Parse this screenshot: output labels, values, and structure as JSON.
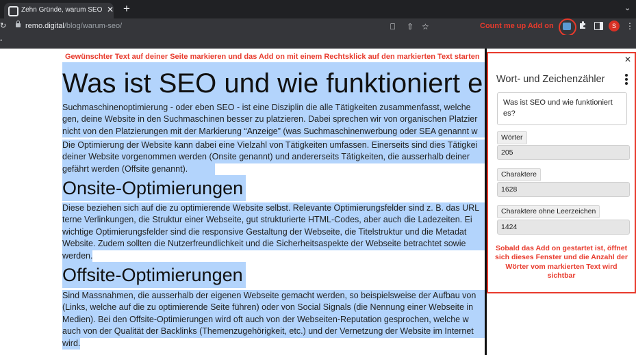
{
  "browser": {
    "tab_title": "Zehn Gründe, warum SEO wich",
    "tab_close": "✕",
    "new_tab": "+",
    "url_host": "remo.digital",
    "url_path": "/blog/warum-seo/"
  },
  "annotations": {
    "toolbar_label": "Count me up Add on",
    "instruction": "Gewünschter Text auf deiner Seite markieren und das Add on mit einem Rechtsklick auf den markierten Text starten",
    "panel_note": "Sobald das Add on gestartet ist, öffnet sich dieses Fenster und die Anzahl der Wörter vom markierten Text wird sichtbar"
  },
  "profile": {
    "initial": "S"
  },
  "article": {
    "title": "Was ist SEO und wie funktioniert e",
    "intro_lines": [
      "Suchmaschinenoptimierung - oder eben SEO - ist eine Disziplin die alle Tätigkeiten zusammenfasst, welche",
      "gen, deine Website in den Suchmaschinen besser zu platzieren. Dabei sprechen wir von organischen Platzier",
      "nicht von den Platzierungen mit der Markierung “Anzeige” (was Suchmaschinenwerbung oder SEA genannt w"
    ],
    "para2_lines": [
      "Die Optimierung der Website kann dabei eine Vielzahl von Tätigkeiten umfassen. Einerseits sind dies Tätigkei",
      "deiner Website vorgenommen werden (Onsite genannt) und andererseits Tätigkeiten, die ausserhalb deiner",
      "gefährt werden (Offsite genannt)."
    ],
    "onsite_heading": "Onsite-Optimierungen",
    "onsite_lines": [
      "Diese beziehen sich auf die zu optimierende Website selbst. Relevante Optimierungsfelder sind z. B. das URL",
      "terne Verlinkungen, die Struktur einer Webseite, gut strukturierte HTML-Codes, aber auch die Ladezeiten. Ei",
      "wichtige Optimierungsfelder sind die responsive Gestaltung der Webseite, die Titelstruktur und die Metadat",
      "Website. Zudem sollten die Nutzerfreundlichkeit und die Sicherheitsaspekte der Webseite betrachtet sowie",
      "werden."
    ],
    "offsite_heading": "Offsite-Optimierungen",
    "offsite_lines": [
      "Sind Massnahmen, die ausserhalb der eigenen Webseite gemacht werden, so beispielsweise der Aufbau von",
      "(Links, welche auf die zu optimierende Seite führen) oder von Social Signals (die Nennung einer Webseite in",
      "Medien). Bei den Offsite-Optimierungen wird oft auch von der Webseiten-Reputation gesprochen, welche w",
      "auch von der Qualität der Backlinks (Themenzugehörigkeit, etc.) und der Vernetzung der Website im Internet",
      "wird."
    ]
  },
  "panel": {
    "title": "Wort- und Zeichenzähler",
    "close": "✕",
    "selected_text": "Was ist SEO und wie funktioniert es?",
    "words_label": "Wörter",
    "words_value": "205",
    "chars_label": "Charaktere",
    "chars_value": "1628",
    "chars_no_space_label": "Charaktere ohne Leerzeichen",
    "chars_no_space_value": "1424"
  },
  "icons": {
    "favicon": "page-favicon-icon",
    "lock": "lock-icon",
    "install": "install-app-icon",
    "share": "share-icon",
    "bookmark": "star-icon",
    "extension": "count-me-up-extension-icon",
    "puzzle": "extensions-puzzle-icon",
    "side_panel": "side-panel-icon",
    "menu": "kebab-menu-icon"
  },
  "colors": {
    "annotation_red": "#e83a2c",
    "selection": "#b3d4fc",
    "chrome_dark": "#202124",
    "chrome_toolbar": "#35363a"
  }
}
